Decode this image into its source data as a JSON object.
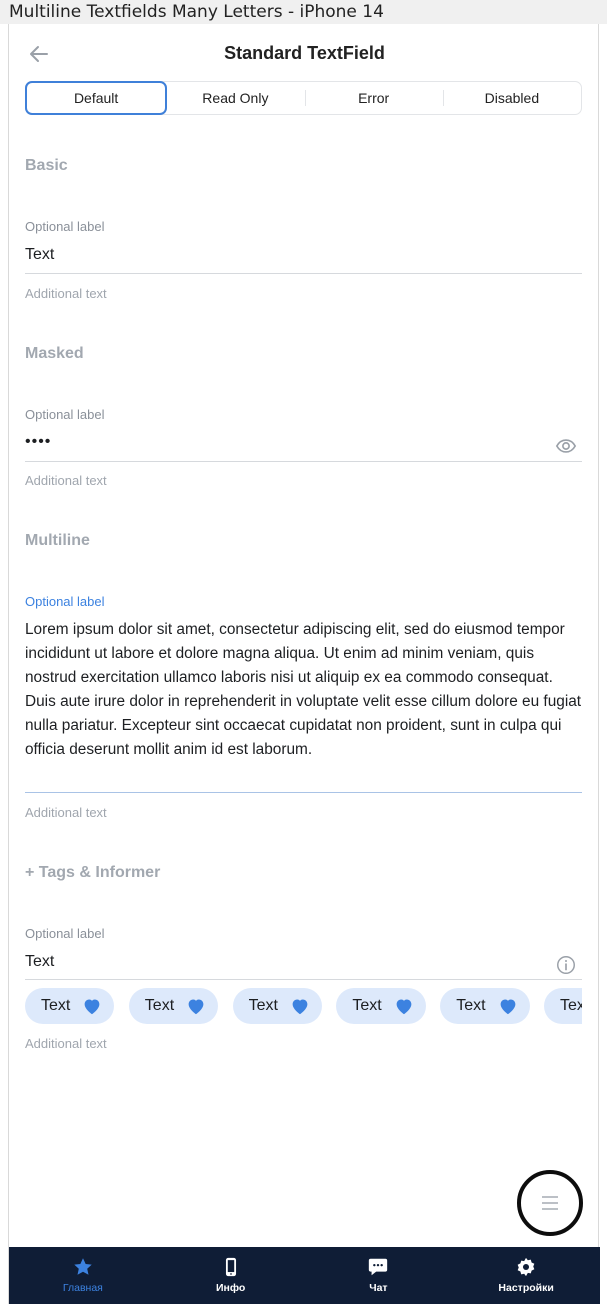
{
  "window": {
    "title": "Multiline Textfields Many Letters - iPhone 14"
  },
  "header": {
    "title": "Standard TextField"
  },
  "segments": [
    {
      "label": "Default",
      "active": true
    },
    {
      "label": "Read Only",
      "active": false
    },
    {
      "label": "Error",
      "active": false
    },
    {
      "label": "Disabled",
      "active": false
    }
  ],
  "sections": {
    "basic": {
      "title": "Basic",
      "label": "Optional label",
      "value": "Text",
      "helper": "Additional text"
    },
    "masked": {
      "title": "Masked",
      "label": "Optional label",
      "value": "••••",
      "helper": "Additional text",
      "trailing_icon": "eye-icon"
    },
    "multiline": {
      "title": "Multiline",
      "label": "Optional label",
      "value": "Lorem ipsum dolor sit amet, consectetur adipiscing elit, sed do eiusmod tempor incididunt ut labore et dolore magna aliqua. Ut enim ad minim veniam, quis nostrud exercitation ullamco laboris nisi ut aliquip ex ea commodo consequat. Duis aute irure dolor in reprehenderit in voluptate velit esse cillum dolore eu fugiat nulla pariatur. Excepteur sint occaecat cupidatat non proident, sunt in culpa qui officia deserunt mollit anim id est laborum.",
      "helper": "Additional text"
    },
    "tags": {
      "title": "+ Tags & Informer",
      "label": "Optional label",
      "value": "Text",
      "helper": "Additional text",
      "trailing_icon": "info-icon",
      "chips": [
        "Text",
        "Text",
        "Text",
        "Text",
        "Text",
        "Text"
      ]
    }
  },
  "fab": {
    "icon": "menu-icon"
  },
  "tabbar": [
    {
      "label": "Главная",
      "icon": "star-icon",
      "active": true
    },
    {
      "label": "Инфо",
      "icon": "phone-icon",
      "active": false
    },
    {
      "label": "Чат",
      "icon": "chat-icon",
      "active": false
    },
    {
      "label": "Настройки",
      "icon": "gear-icon",
      "active": false
    }
  ],
  "colors": {
    "accent": "#3c82e0",
    "tabbar_bg": "#0f1d36",
    "chip_bg": "#dde9fb",
    "muted": "#a2a8b0"
  }
}
